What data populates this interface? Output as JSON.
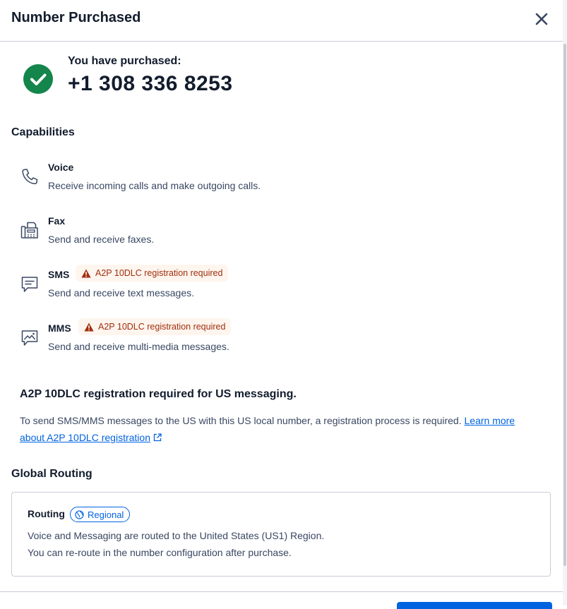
{
  "dialog": {
    "title": "Number Purchased",
    "close_icon": "close-icon"
  },
  "purchase": {
    "label": "You have purchased:",
    "phone_number": "+1 308 336 8253",
    "status_icon": "check-circle-icon",
    "status_color": "#14854b"
  },
  "capabilities": {
    "heading": "Capabilities",
    "items": [
      {
        "name": "Voice",
        "description": "Receive incoming calls and make outgoing calls.",
        "icon": "phone-icon",
        "badge": ""
      },
      {
        "name": "Fax",
        "description": "Send and receive faxes.",
        "icon": "fax-icon",
        "badge": ""
      },
      {
        "name": "SMS",
        "description": "Send and receive text messages.",
        "icon": "sms-icon",
        "badge": "A2P 10DLC registration required"
      },
      {
        "name": "MMS",
        "description": "Send and receive multi-media messages.",
        "icon": "mms-icon",
        "badge": "A2P 10DLC registration required"
      }
    ],
    "warning_color": "#a12e0e",
    "warning_bg": "#fef5ee"
  },
  "a2p": {
    "heading": "A2P 10DLC registration required for US messaging.",
    "body": "To send SMS/MMS messages to the US with this US local number, a registration process is required. ",
    "link_text": "Learn more about A2P 10DLC registration",
    "link_color": "#0263e0"
  },
  "routing": {
    "section_heading": "Global Routing",
    "label": "Routing",
    "region_badge": "Regional",
    "line1": "Voice and Messaging are routed to the United States (US1) Region.",
    "line2": "You can re-route in the number configuration after purchase."
  },
  "footer": {
    "primary_color": "#0263e0"
  }
}
